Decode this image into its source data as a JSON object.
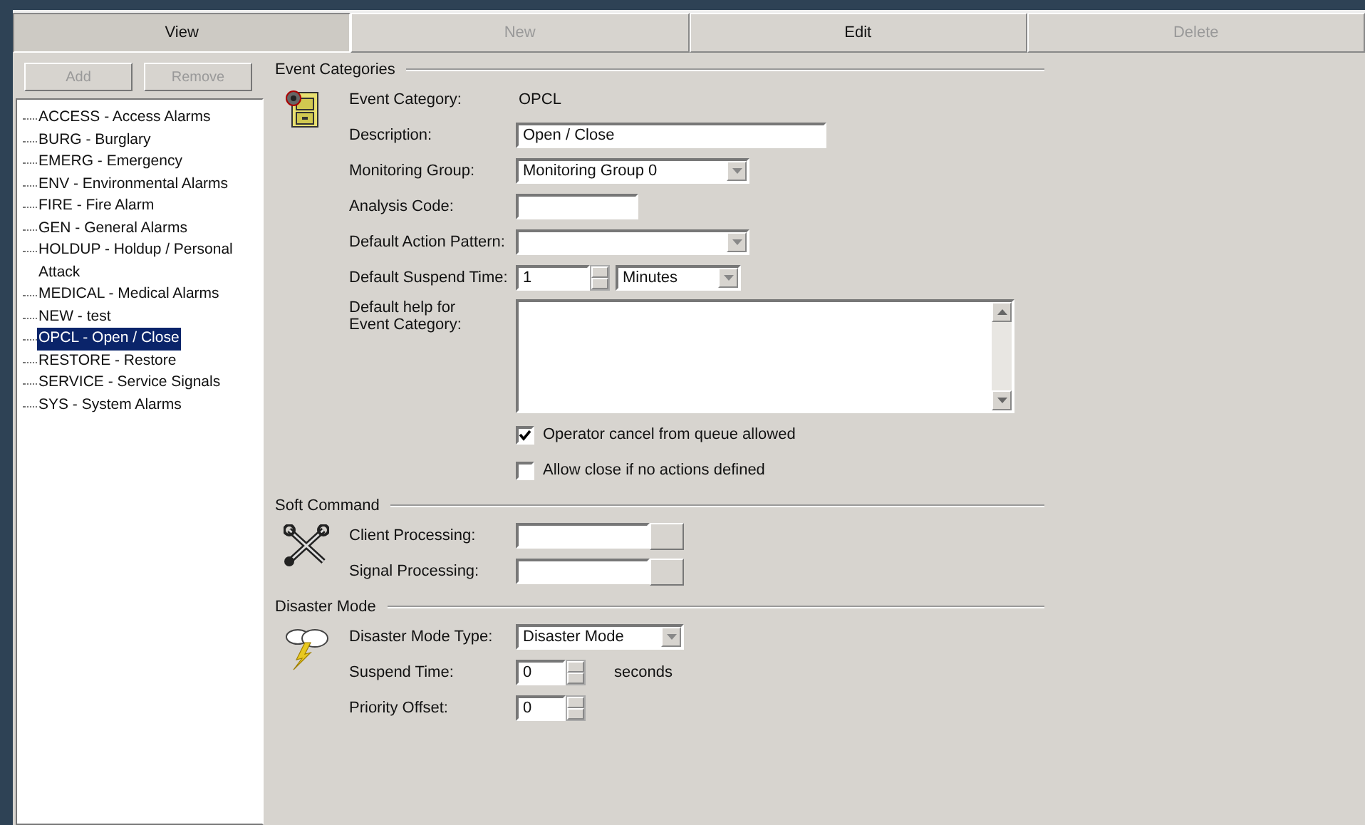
{
  "toolbar": [
    {
      "label": "View",
      "selected": true,
      "disabled": false
    },
    {
      "label": "New",
      "selected": false,
      "disabled": true
    },
    {
      "label": "Edit",
      "selected": false,
      "disabled": false
    },
    {
      "label": "Delete",
      "selected": false,
      "disabled": true
    }
  ],
  "list_buttons": [
    {
      "label": "Add",
      "disabled": true
    },
    {
      "label": "Remove",
      "disabled": true
    }
  ],
  "categories": [
    {
      "label": "ACCESS - Access Alarms",
      "selected": false
    },
    {
      "label": "BURG - Burglary",
      "selected": false
    },
    {
      "label": "EMERG - Emergency",
      "selected": false
    },
    {
      "label": "ENV - Environmental Alarms",
      "selected": false
    },
    {
      "label": "FIRE - Fire Alarm",
      "selected": false
    },
    {
      "label": "GEN - General Alarms",
      "selected": false
    },
    {
      "label": "HOLDUP - Holdup / Personal Attack",
      "selected": false
    },
    {
      "label": "MEDICAL - Medical Alarms",
      "selected": false
    },
    {
      "label": "NEW - test",
      "selected": false
    },
    {
      "label": "OPCL - Open / Close",
      "selected": true
    },
    {
      "label": "RESTORE - Restore",
      "selected": false
    },
    {
      "label": "SERVICE - Service Signals",
      "selected": false
    },
    {
      "label": "SYS - System Alarms",
      "selected": false
    }
  ],
  "sections": [
    {
      "title": "Event Categories",
      "kind": "cabinet",
      "rows": [
        {
          "kind": "static",
          "label": "Event Category:",
          "value": "OPCL"
        },
        {
          "kind": "wide-input",
          "label": "Description:",
          "value": "Open / Close"
        },
        {
          "kind": "combo",
          "label": "Monitoring Group:",
          "value": "Monitoring Group 0"
        },
        {
          "kind": "short-input",
          "label": "Analysis Code:"
        },
        {
          "kind": "combo",
          "label": "Default Action Pattern:"
        },
        {
          "kind": "spin-combo",
          "label": "Default Suspend Time:",
          "value": "1",
          "unit": "Minutes"
        },
        {
          "kind": "memo",
          "label": "Default help for Event Category:"
        },
        {
          "kind": "checkbox",
          "label": "Operator cancel from queue allowed",
          "checked": true
        },
        {
          "kind": "checkbox",
          "label": "Allow close if no actions defined",
          "checked": false
        }
      ]
    },
    {
      "title": "Soft Command",
      "kind": "tools",
      "rows": [
        {
          "kind": "browse",
          "label": "Client Processing:"
        },
        {
          "kind": "browse",
          "label": "Signal Processing:"
        }
      ]
    },
    {
      "title": "Disaster Mode",
      "kind": "storm",
      "rows": [
        {
          "kind": "small-combo",
          "label": "Disaster Mode Type:",
          "value": "Disaster Mode"
        },
        {
          "kind": "spin",
          "label": "Suspend Time:",
          "value": "0",
          "unit": "seconds"
        },
        {
          "kind": "spin",
          "label": "Priority Offset:",
          "value": "0"
        }
      ]
    }
  ]
}
